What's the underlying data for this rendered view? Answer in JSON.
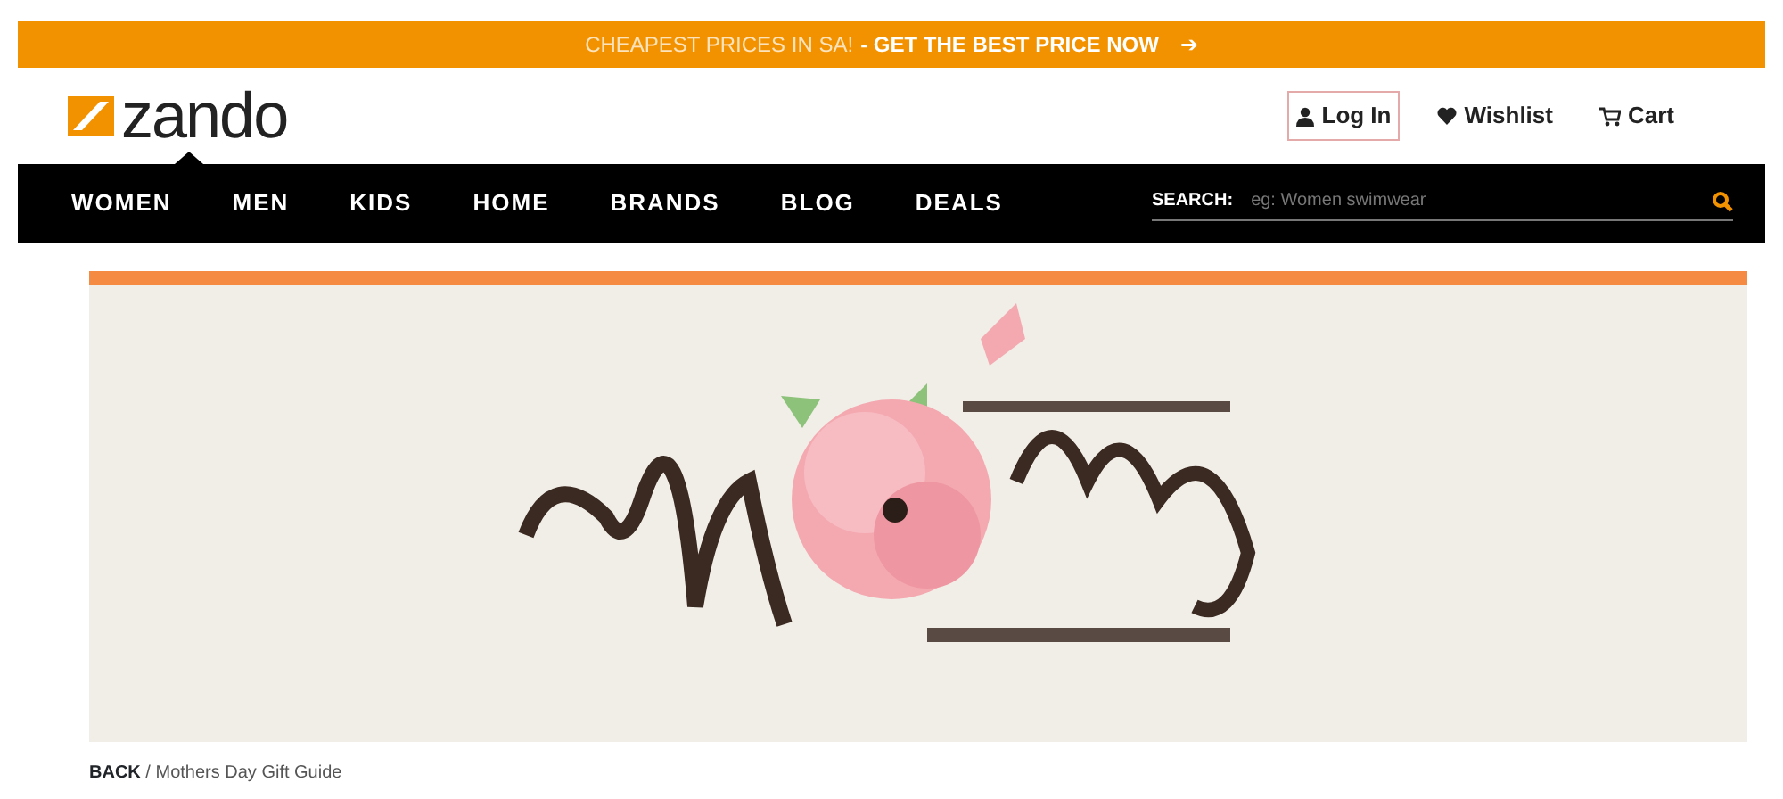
{
  "promo_bar": {
    "text": "CHEAPEST PRICES IN SA!",
    "link": "- GET THE BEST PRICE NOW",
    "arrow": "➔"
  },
  "header": {
    "logo": "zando",
    "account_links": [
      {
        "kind": "login",
        "label": "Log In",
        "outlined": true
      },
      {
        "kind": "wishlist",
        "label": "Wishlist",
        "outlined": false
      },
      {
        "kind": "cart",
        "label": "Cart",
        "outlined": false
      }
    ]
  },
  "nav": {
    "items": [
      "WOMEN",
      "MEN",
      "KIDS",
      "HOME",
      "BRANDS",
      "BLOG",
      "DEALS"
    ],
    "search": {
      "label": "SEARCH:",
      "placeholder": "eg: Women swimwear"
    }
  },
  "breadcrumb": {
    "back": "BACK",
    "separator": "/",
    "current": "Mothers Day Gift Guide"
  }
}
